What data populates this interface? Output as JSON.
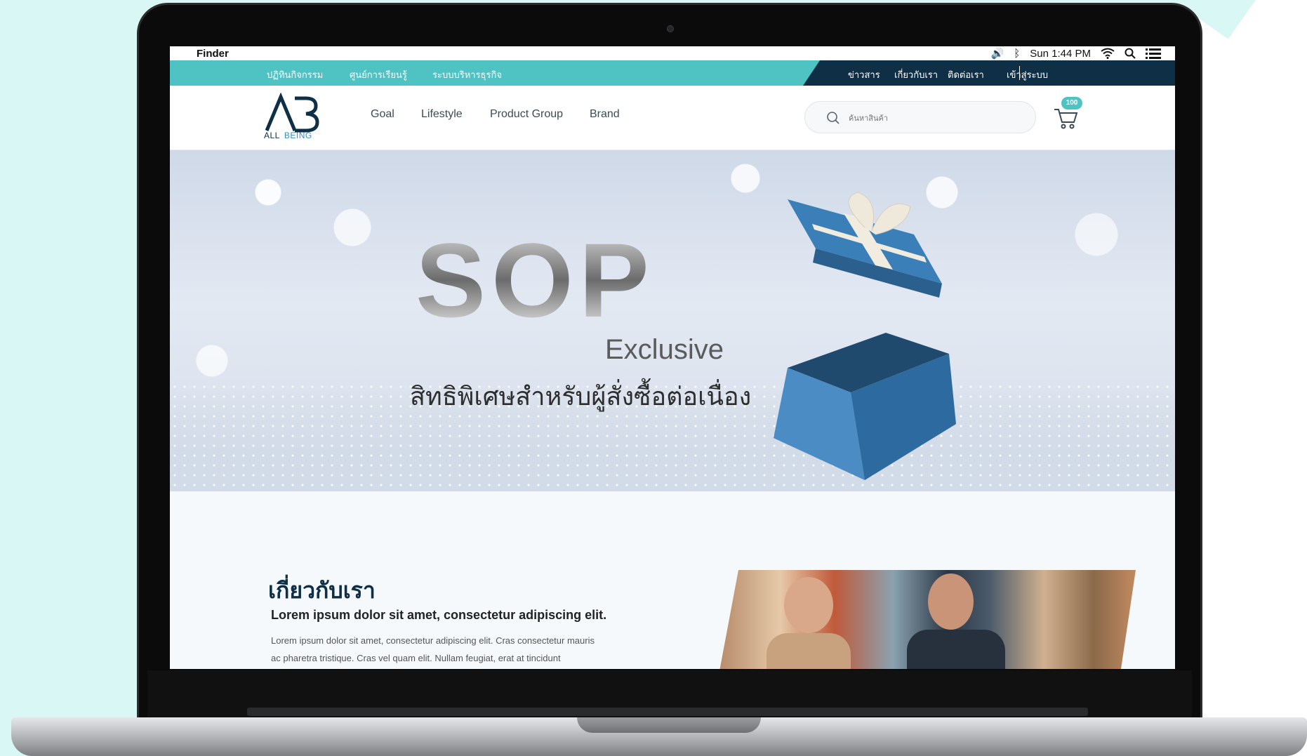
{
  "menubar": {
    "apple": "",
    "app_name": "Finder",
    "volume": "🔊",
    "bluetooth": "ᛒ",
    "clock": "Sun 1:44 PM",
    "wifi": "wifi-icon",
    "search": "search-icon",
    "list": "list-icon"
  },
  "topbar": {
    "left_links": [
      "ปฏิทินกิจกรรม",
      "ศูนย์การเรียนรู้",
      "ระบบบริหารธุรกิจ"
    ],
    "right_links": [
      "ข่าวสาร",
      "เกี่ยวกับเรา",
      "ติดต่อเรา"
    ],
    "login": "เข้าสู่ระบบ",
    "colors": {
      "teal": "#4fc2c4",
      "navy": "#0e2f45"
    }
  },
  "header": {
    "logo_all": "ALL",
    "logo_being": "BEING",
    "nav": [
      "Goal",
      "Lifestyle",
      "Product Group",
      "Brand"
    ],
    "search_placeholder": "ค้นหาสินค้า",
    "cart_count": "100"
  },
  "banner": {
    "headline": "SOP",
    "subheadline": "Exclusive",
    "tagline": "สิทธิพิเศษสำหรับผู้สั่งซื้อต่อเนื่อง"
  },
  "about": {
    "title": "เกี่ยวกับเรา",
    "subtitle": "Lorem ipsum dolor sit amet, consectetur adipiscing elit.",
    "body_line1": "Lorem ipsum dolor sit amet, consectetur adipiscing elit. Cras consectetur mauris",
    "body_line2": "ac pharetra tristique. Cras vel quam elit. Nullam feugiat, erat at tincidunt"
  }
}
